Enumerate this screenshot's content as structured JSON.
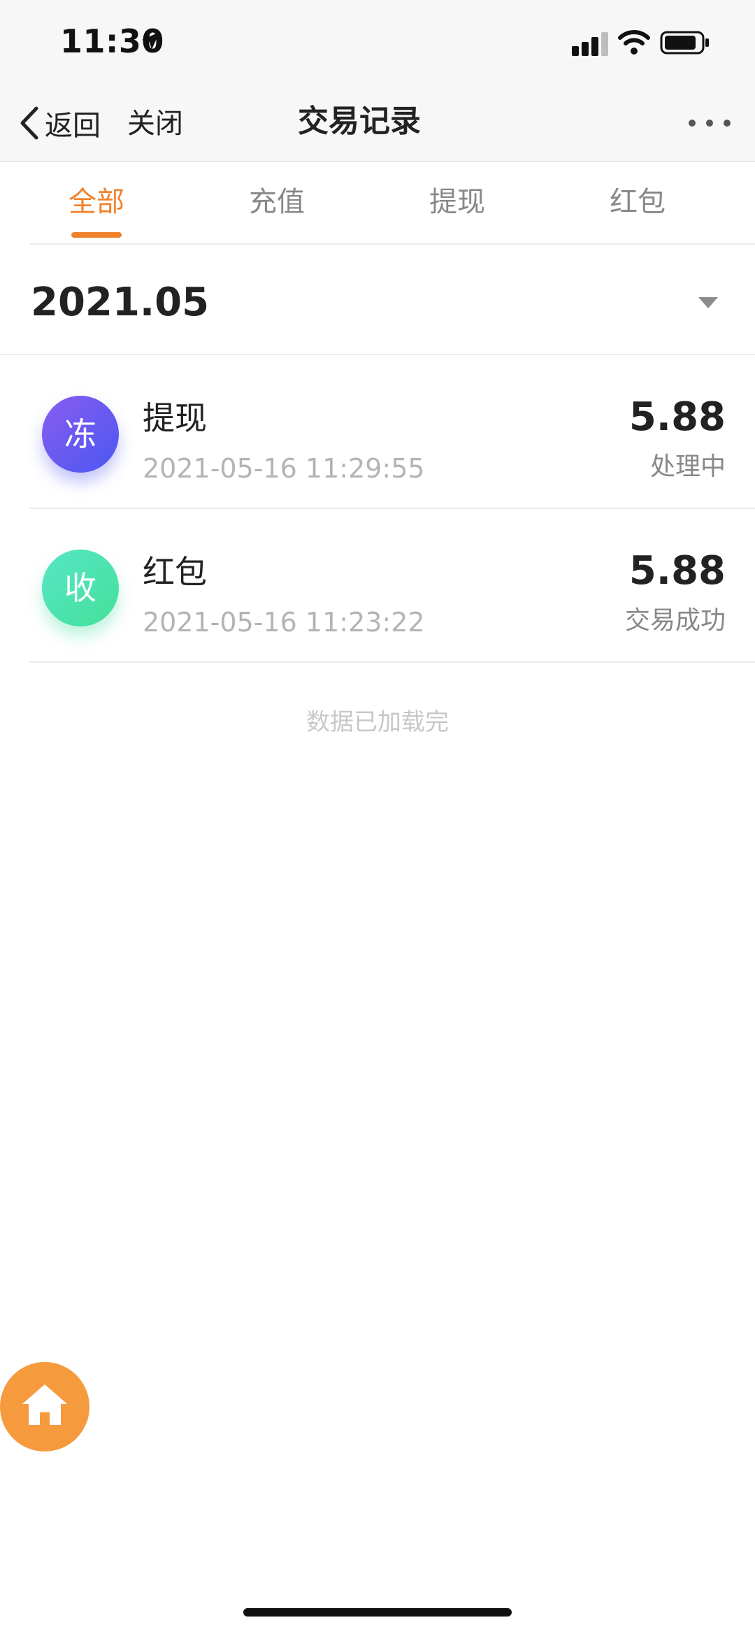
{
  "status_bar": {
    "time": "11:30"
  },
  "nav": {
    "back_label": "返回",
    "close_label": "关闭",
    "title": "交易记录"
  },
  "tabs": [
    {
      "label": "全部",
      "active": true
    },
    {
      "label": "充值",
      "active": false
    },
    {
      "label": "提现",
      "active": false
    },
    {
      "label": "红包",
      "active": false
    }
  ],
  "month": {
    "label": "2021.05"
  },
  "transactions": [
    {
      "avatar_char": "冻",
      "avatar_color": "#5a5af2",
      "name": "提现",
      "time": "2021-05-16 11:29:55",
      "amount": "5.88",
      "status": "处理中"
    },
    {
      "avatar_char": "收",
      "avatar_color": "#4ee0b0",
      "name": "红包",
      "time": "2021-05-16 11:23:22",
      "amount": "5.88",
      "status": "交易成功"
    }
  ],
  "list_footer": "数据已加载完",
  "colors": {
    "accent": "#f0822c",
    "home_button": "#f59a3d"
  },
  "icons": {
    "back": "chevron-left-icon",
    "more": "more-dots-icon",
    "month_dropdown": "caret-down-icon",
    "home": "home-icon"
  }
}
